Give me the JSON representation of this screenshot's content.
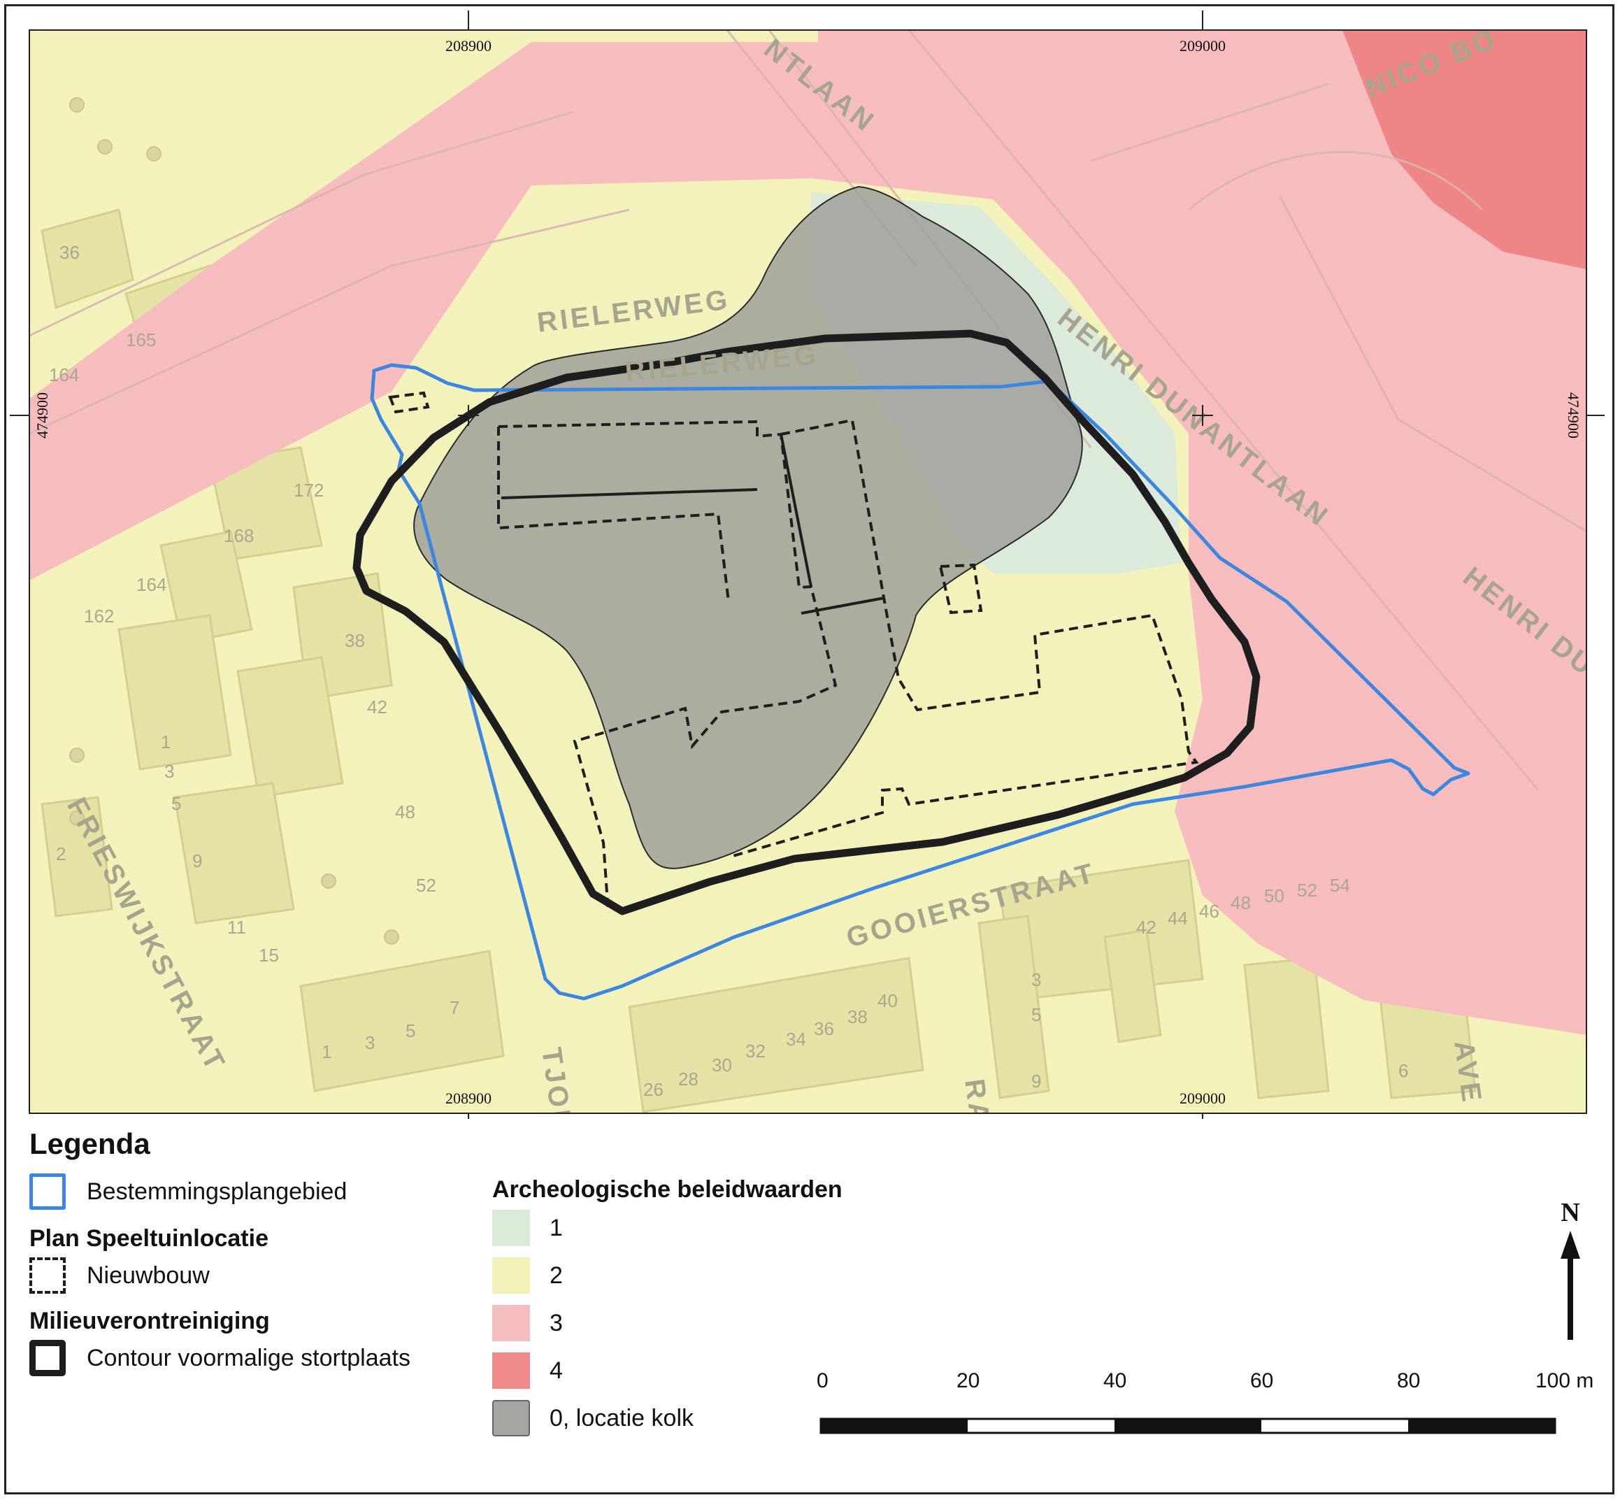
{
  "map": {
    "coordinates": {
      "x_top": [
        "208900",
        "209000"
      ],
      "x_bottom": [
        "208900",
        "209000"
      ],
      "y_left": "474900",
      "y_right": "474900"
    },
    "street_labels": [
      "RIELERWEG",
      "RIELERWEG",
      "HENRI DUNANTLAAN",
      "HENRI DU",
      "NICO BO",
      "NTLAAN",
      "GOOIERSTRAAT",
      "FRIESWIJKSTRAAT",
      "TJOE",
      "AVE",
      "RA"
    ],
    "house_numbers": [
      "36",
      "165",
      "164",
      "172",
      "168",
      "164",
      "162",
      "38",
      "42",
      "48",
      "52",
      "1",
      "3",
      "5",
      "9",
      "11",
      "15",
      "2",
      "1",
      "3",
      "5",
      "7",
      "26",
      "28",
      "30",
      "32",
      "34",
      "36",
      "38",
      "40",
      "42",
      "44",
      "46",
      "48",
      "50",
      "52",
      "54",
      "3",
      "5",
      "9",
      "6"
    ],
    "colors": {
      "value_1": "#dcebd9",
      "value_2": "#f2f2b8",
      "value_3": "#f6bdbf",
      "value_4": "#ee8a8c",
      "kolk": "#9d9c97",
      "plan_boundary": "#3a86e0",
      "landfill_contour": "#1e1e1e",
      "new_build": "#1e1e1e"
    }
  },
  "legend": {
    "title": "Legenda",
    "items": [
      {
        "label": "Bestemmingsplangebied",
        "symbol": "blue-outline"
      }
    ],
    "group_plan": {
      "title": "Plan Speeltuinlocatie",
      "items": [
        {
          "label": "Nieuwbouw",
          "symbol": "dashed-outline"
        }
      ]
    },
    "group_pollution": {
      "title": "Milieuverontreiniging",
      "items": [
        {
          "label": "Contour voormalige stortplaats",
          "symbol": "thick-outline"
        }
      ]
    },
    "group_arch": {
      "title": "Archeologische beleidwaarden",
      "items": [
        {
          "label": "1",
          "color": "#dcebd9"
        },
        {
          "label": "2",
          "color": "#f2f2b8"
        },
        {
          "label": "3",
          "color": "#f6bdbf"
        },
        {
          "label": "4",
          "color": "#ee8a8c"
        },
        {
          "label": "0, locatie kolk",
          "color": "#a7a6a2"
        }
      ]
    }
  },
  "scale_bar": {
    "labels": [
      "0",
      "20",
      "40",
      "60",
      "80",
      "100 m"
    ]
  },
  "north_arrow": {
    "label": "N"
  }
}
